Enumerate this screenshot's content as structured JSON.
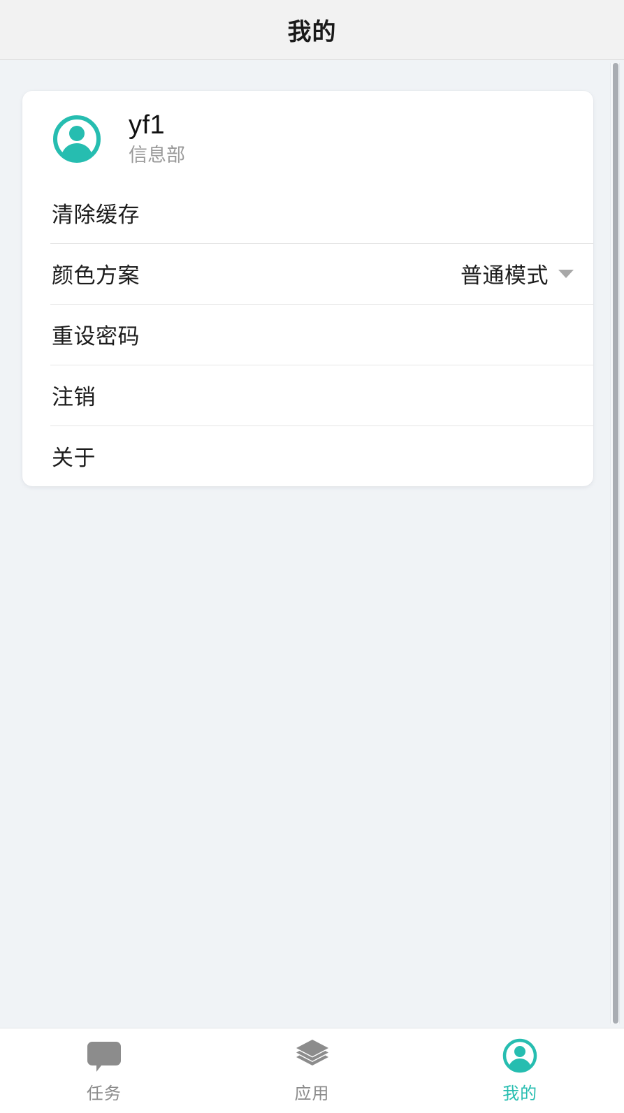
{
  "header": {
    "title": "我的"
  },
  "colors": {
    "accent": "#26bdb0",
    "page_background": "#f0f3f6",
    "header_background": "#f2f2f2",
    "card_background": "#ffffff",
    "primary_text": "#1c1c1c",
    "secondary_text": "#9a9a9a",
    "inactive_tab": "#8c8c8c",
    "divider": "#e6e6e6"
  },
  "profile": {
    "avatar_icon": "user-circle-icon",
    "name": "yf1",
    "department": "信息部"
  },
  "menu": {
    "items": [
      {
        "label": "清除缓存",
        "value": "",
        "has_caret": false
      },
      {
        "label": "颜色方案",
        "value": "普通模式",
        "has_caret": true
      },
      {
        "label": "重设密码",
        "value": "",
        "has_caret": false
      },
      {
        "label": "注销",
        "value": "",
        "has_caret": false
      },
      {
        "label": "关于",
        "value": "",
        "has_caret": false
      }
    ]
  },
  "tabbar": {
    "items": [
      {
        "label": "任务",
        "icon": "chat-bubble-icon",
        "active": false
      },
      {
        "label": "应用",
        "icon": "layers-icon",
        "active": false
      },
      {
        "label": "我的",
        "icon": "user-circle-icon",
        "active": true
      }
    ]
  },
  "scrollbar": {
    "visible": true
  }
}
